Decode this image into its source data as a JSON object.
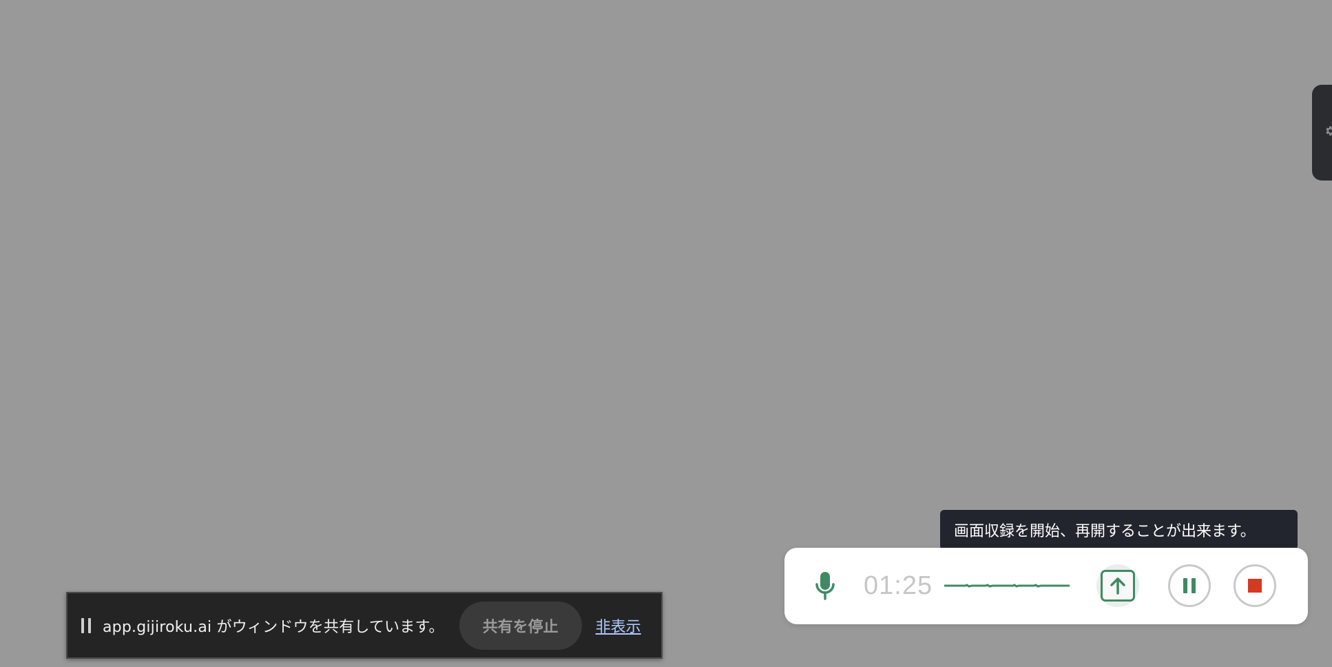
{
  "share_bar": {
    "message": "app.gijiroku.ai がウィンドウを共有しています。",
    "stop_label": "共有を停止",
    "hide_label": "非表示"
  },
  "recorder": {
    "timer": "01:25",
    "tooltip": "画面収録を開始、再開することが出来ます。",
    "icons": {
      "mic": "microphone-icon",
      "upload": "upload-arrow-icon",
      "pause": "pause-icon",
      "stop": "stop-square-icon"
    }
  },
  "side_tab": {
    "icon": "gear-icon"
  },
  "colors": {
    "background": "#999999",
    "accent_green": "#3f8a63",
    "stop_red": "#d33a22",
    "share_bar_bg": "#242424",
    "tooltip_bg": "#22252d",
    "link_blue": "#aec8ff"
  }
}
